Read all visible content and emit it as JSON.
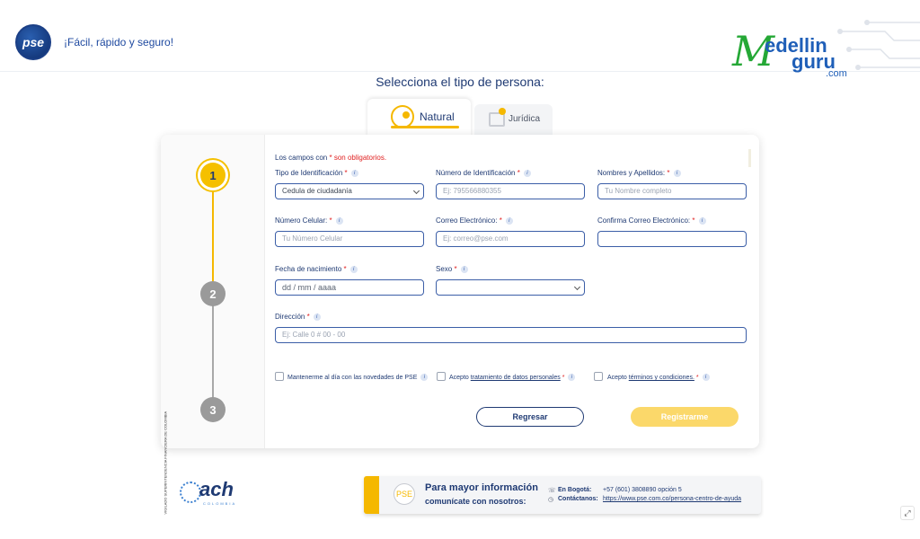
{
  "header": {
    "logo_text": "pse",
    "tagline": "¡Fácil, rápido y seguro!",
    "watermark": {
      "m": "M",
      "edellin": "edellin",
      "guru": "guru",
      "com": ".com"
    }
  },
  "section_title": "Selecciona el tipo de persona:",
  "tabs": [
    {
      "label": "Natural",
      "active": true,
      "icon": "person-natural-icon"
    },
    {
      "label": "Jurídica",
      "active": false,
      "icon": "building-icon"
    }
  ],
  "steps": [
    "1",
    "2",
    "3"
  ],
  "form": {
    "note_prefix": "Los campos con ",
    "note_required": "* son obligatorios.",
    "fields": [
      {
        "label": "Tipo de Identificación",
        "value": "Cedula de ciudadanía",
        "placeholder": ""
      },
      {
        "label": "Número de Identificación",
        "value": "",
        "placeholder": "Ej: 795566880355"
      },
      {
        "label": "Nombres y Apellidos:",
        "value": "",
        "placeholder": "Tu Nombre completo"
      },
      {
        "label": "Número Celular:",
        "value": "",
        "placeholder": "Tu Número Celular"
      },
      {
        "label": "Correo Electrónico:",
        "value": "",
        "placeholder": "Ej: correo@pse.com"
      },
      {
        "label": "Confirma Correo Electrónico:",
        "value": "",
        "placeholder": ""
      },
      {
        "label": "Fecha de nacimiento",
        "value": "dd / mm / aaaa",
        "placeholder": ""
      },
      {
        "label": "Sexo",
        "value": "",
        "placeholder": ""
      },
      {
        "label": "Dirección",
        "value": "",
        "placeholder": "Ej: Calle 0 # 00 - 00"
      }
    ],
    "required_mark": "*",
    "info_mark": "i",
    "checks": [
      {
        "text": "Mantenerme al día con las novedades de PSE",
        "link": "",
        "required": false
      },
      {
        "text": "Acepto ",
        "link": "tratamiento de datos personales",
        "required": true
      },
      {
        "text": "Acepto ",
        "link": "términos y condiciones.",
        "required": true
      }
    ],
    "back_label": "Regresar",
    "submit_label": "Registrarme"
  },
  "footer": {
    "badge_text": "VIGILADO SUPERINTENDENCIA FINANCIERA DE COLOMBIA",
    "ach": {
      "word": "ach",
      "sub": "COLOMBIA"
    },
    "help": {
      "title": "Para mayor información",
      "subtitle": "comunícate con nosotros:",
      "icon_text": "PSE",
      "phone_label": "En Bogotá:",
      "phone_value": "+57 (601) 3808890 opción 5",
      "contact_label": "Contáctanos:",
      "contact_value": "https://www.pse.com.co/persona-centro-de-ayuda"
    }
  },
  "colors": {
    "accent": "#f5b800",
    "primary": "#1f3a73",
    "required": "#e02020"
  }
}
